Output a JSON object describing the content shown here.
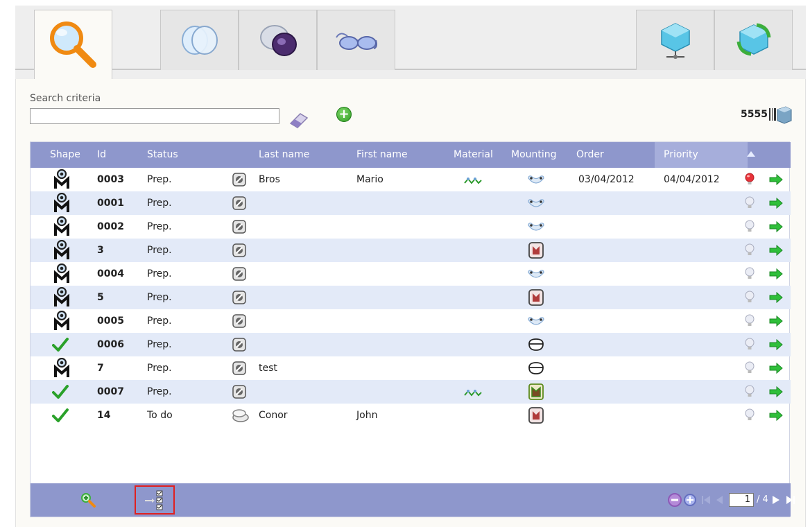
{
  "search": {
    "label": "Search criteria",
    "value": "",
    "placeholder": ""
  },
  "count": "5555",
  "tabs": [
    "search-icon",
    "lens-icon",
    "lens-frame-icon",
    "glasses-icon",
    "network-icon",
    "sync-icon"
  ],
  "table": {
    "headers": {
      "shape": "Shape",
      "id": "Id",
      "status": "Status",
      "last_name": "Last name",
      "first_name": "First name",
      "material": "Material",
      "mounting": "Mounting",
      "order": "Order",
      "priority": "Priority"
    },
    "rows": [
      {
        "shape": "om",
        "id": "0003",
        "status": "Prep.",
        "job": "drill",
        "last": "Bros",
        "first": "Mario",
        "material": true,
        "mount": "drill",
        "order": "03/04/2012",
        "priority_date": "04/04/2012",
        "urgent": true
      },
      {
        "shape": "om",
        "id": "0001",
        "status": "Prep.",
        "job": "drill",
        "last": "",
        "first": "",
        "material": false,
        "mount": "drill",
        "order": "",
        "priority_date": "",
        "urgent": false
      },
      {
        "shape": "om",
        "id": "0002",
        "status": "Prep.",
        "job": "drill",
        "last": "",
        "first": "",
        "material": false,
        "mount": "drill",
        "order": "",
        "priority_date": "",
        "urgent": false
      },
      {
        "shape": "om",
        "id": "3",
        "status": "Prep.",
        "job": "drill",
        "last": "",
        "first": "",
        "material": false,
        "mount": "frame",
        "order": "",
        "priority_date": "",
        "urgent": false
      },
      {
        "shape": "om",
        "id": "0004",
        "status": "Prep.",
        "job": "drill",
        "last": "",
        "first": "",
        "material": false,
        "mount": "drill",
        "order": "",
        "priority_date": "",
        "urgent": false
      },
      {
        "shape": "om",
        "id": "5",
        "status": "Prep.",
        "job": "drill",
        "last": "",
        "first": "",
        "material": false,
        "mount": "frame",
        "order": "",
        "priority_date": "",
        "urgent": false
      },
      {
        "shape": "om",
        "id": "0005",
        "status": "Prep.",
        "job": "drill",
        "last": "",
        "first": "",
        "material": false,
        "mount": "drill",
        "order": "",
        "priority_date": "",
        "urgent": false
      },
      {
        "shape": "check",
        "id": "0006",
        "status": "Prep.",
        "job": "drill",
        "last": "",
        "first": "",
        "material": false,
        "mount": "nylor",
        "order": "",
        "priority_date": "",
        "urgent": false
      },
      {
        "shape": "om",
        "id": "7",
        "status": "Prep.",
        "job": "drill",
        "last": "test",
        "first": "",
        "material": false,
        "mount": "nylor",
        "order": "",
        "priority_date": "",
        "urgent": false
      },
      {
        "shape": "check",
        "id": "0007",
        "status": "Prep.",
        "job": "drill",
        "last": "",
        "first": "",
        "material": true,
        "mount": "frame-green",
        "order": "",
        "priority_date": "",
        "urgent": false
      },
      {
        "shape": "check",
        "id": "14",
        "status": "To do",
        "job": "todo",
        "last": "Conor",
        "first": "John",
        "material": false,
        "mount": "frame",
        "order": "",
        "priority_date": "",
        "urgent": false
      }
    ]
  },
  "pager": {
    "current": "1",
    "total": "/ 4"
  },
  "colors": {
    "header": "#8e97cc",
    "alt_row": "#e3eaf8",
    "accent_green": "#2fbf3a"
  }
}
